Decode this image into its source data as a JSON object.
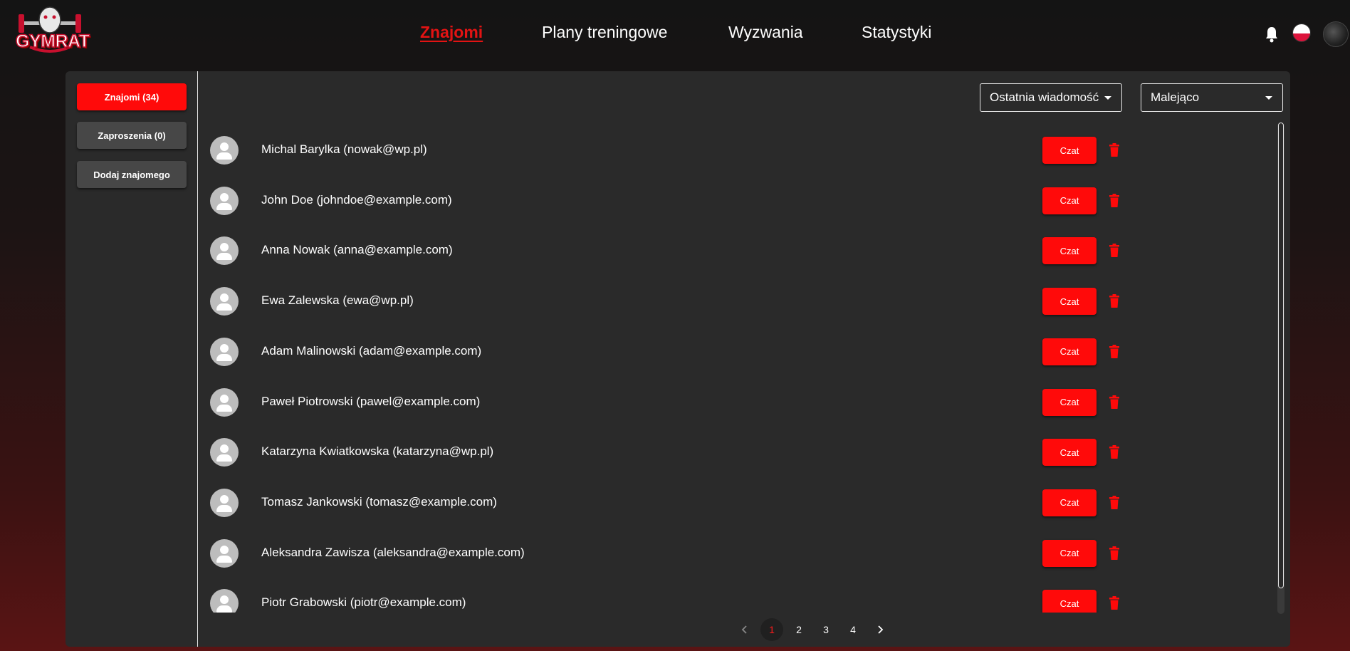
{
  "header": {
    "logo_text": "GYMRAT",
    "nav": [
      {
        "label": "Znajomi"
      },
      {
        "label": "Plany treningowe"
      },
      {
        "label": "Wyzwania"
      },
      {
        "label": "Statystyki"
      }
    ],
    "accent_color": "#ff0a0a"
  },
  "sidebar": {
    "items": [
      {
        "label": "Znajomi (34)"
      },
      {
        "label": "Zaproszenia (0)"
      },
      {
        "label": "Dodaj znajomego"
      }
    ]
  },
  "sort": {
    "field_value": "Ostatnia wiadomość",
    "order_value": "Malejąco"
  },
  "friends": [
    {
      "name": "Michal Barylka (nowak@wp.pl)",
      "chat_label": "Czat"
    },
    {
      "name": "John Doe (johndoe@example.com)",
      "chat_label": "Czat"
    },
    {
      "name": "Anna Nowak (anna@example.com)",
      "chat_label": "Czat"
    },
    {
      "name": "Ewa Zalewska (ewa@wp.pl)",
      "chat_label": "Czat"
    },
    {
      "name": "Adam Malinowski (adam@example.com)",
      "chat_label": "Czat"
    },
    {
      "name": "Paweł Piotrowski (pawel@example.com)",
      "chat_label": "Czat"
    },
    {
      "name": "Katarzyna Kwiatkowska (katarzyna@wp.pl)",
      "chat_label": "Czat"
    },
    {
      "name": "Tomasz Jankowski (tomasz@example.com)",
      "chat_label": "Czat"
    },
    {
      "name": "Aleksandra Zawisza (aleksandra@example.com)",
      "chat_label": "Czat"
    },
    {
      "name": "Piotr Grabowski (piotr@example.com)",
      "chat_label": "Czat"
    }
  ],
  "pagination": {
    "pages": [
      "1",
      "2",
      "3",
      "4"
    ],
    "current": "1"
  }
}
